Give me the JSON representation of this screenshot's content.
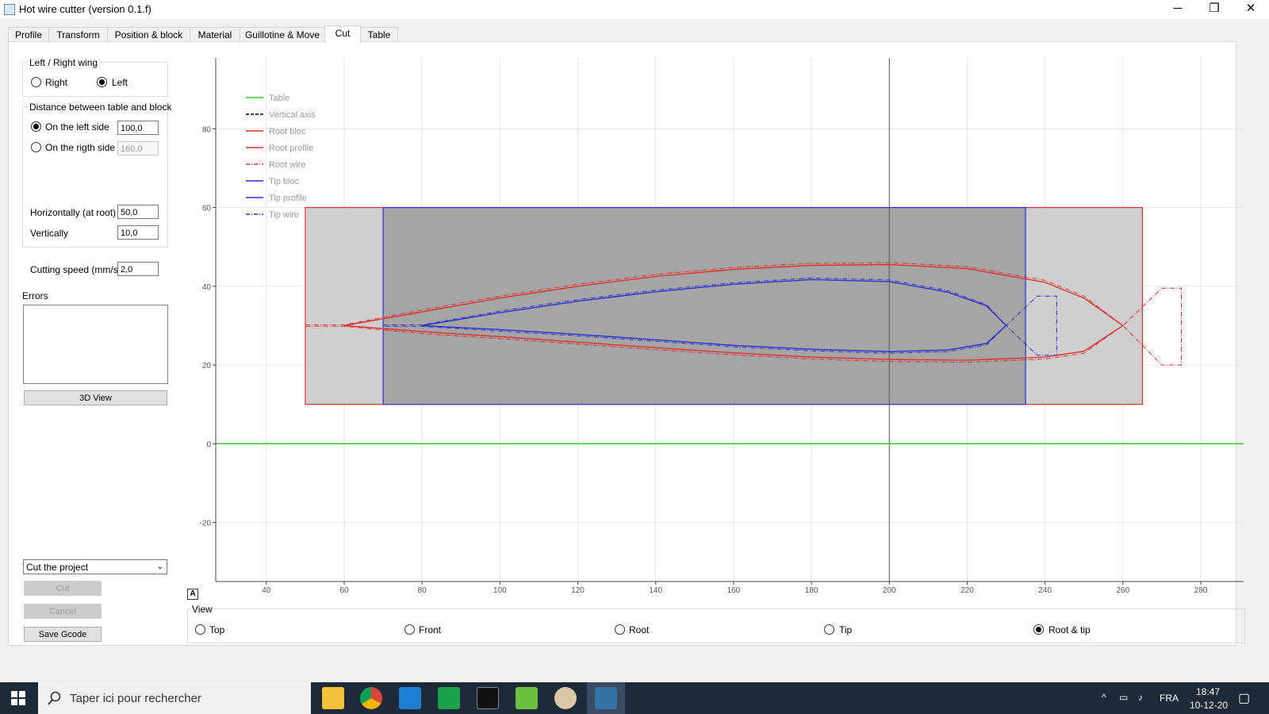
{
  "window": {
    "title": "Hot wire cutter (version 0.1.f)",
    "minimize": "─",
    "maximize": "❐",
    "close": "✕"
  },
  "tabs": [
    "Profile",
    "Transform",
    "Position & block",
    "Material",
    "Guillotine & Move",
    "Cut",
    "Table"
  ],
  "active_tab": "Cut",
  "wing_group": {
    "title": "Left / Right wing",
    "right": "Right",
    "left": "Left",
    "selected": "Left"
  },
  "distance_group": {
    "title": "Distance between table and block",
    "left_side_label": "On the left side",
    "left_side_value": "100,0",
    "right_side_label": "On the rigth side",
    "right_side_value": "160,0",
    "selected": "left",
    "horiz_label": "Horizontally (at root)",
    "horiz_value": "50,0",
    "vert_label": "Vertically",
    "vert_value": "10,0"
  },
  "cutting_speed": {
    "label": "Cutting speed (mm/s)",
    "value": "2,0"
  },
  "errors": {
    "label": "Errors",
    "text": ""
  },
  "buttons": {
    "view3d": "3D View",
    "cut": "Cut",
    "cancel": "Cancel",
    "save_gcode": "Save Gcode"
  },
  "mode_combo": "Cut the project",
  "autoscale_glyph": "A",
  "view_group": {
    "title": "View",
    "options": [
      "Top",
      "Front",
      "Root",
      "Tip",
      "Root & tip"
    ],
    "selected": "Root & tip"
  },
  "chart_data": {
    "type": "line",
    "xlim": [
      27,
      291
    ],
    "ylim": [
      -35,
      98
    ],
    "x_ticks": [
      40,
      60,
      80,
      100,
      120,
      140,
      160,
      180,
      200,
      220,
      240,
      260,
      280
    ],
    "y_ticks": [
      -20,
      0,
      20,
      40,
      60,
      80
    ],
    "grid": true,
    "legend_position": "top-left",
    "legend": [
      {
        "name": "Table",
        "color": "#33cc33",
        "style": "solid"
      },
      {
        "name": "Vertical axis",
        "color": "#000000",
        "style": "dashed"
      },
      {
        "name": "Root bloc",
        "color": "#e03030",
        "style": "solid"
      },
      {
        "name": "Root profile",
        "color": "#e03030",
        "style": "solid"
      },
      {
        "name": "Root wire",
        "color": "#e03030",
        "style": "dashdot"
      },
      {
        "name": "Tip bloc",
        "color": "#2f2fd0",
        "style": "solid"
      },
      {
        "name": "Tip profile",
        "color": "#2f2fd0",
        "style": "solid"
      },
      {
        "name": "Tip wire",
        "color": "#2f2fd0",
        "style": "dashdot"
      }
    ],
    "table_y": 0,
    "vertical_axis_x": 200,
    "root_bloc": {
      "x": [
        50,
        265
      ],
      "y": [
        10,
        60
      ]
    },
    "tip_bloc": {
      "x": [
        70,
        235
      ],
      "y": [
        10,
        60
      ]
    },
    "root_profile": {
      "upper": [
        [
          60,
          30
        ],
        [
          80,
          33.5
        ],
        [
          100,
          37
        ],
        [
          120,
          40
        ],
        [
          140,
          42.5
        ],
        [
          160,
          44.3
        ],
        [
          180,
          45.3
        ],
        [
          200,
          45.5
        ],
        [
          220,
          44.5
        ],
        [
          240,
          41
        ],
        [
          250,
          37
        ],
        [
          260,
          30
        ]
      ],
      "lower": [
        [
          60,
          30
        ],
        [
          80,
          28.5
        ],
        [
          100,
          27.2
        ],
        [
          120,
          25.8
        ],
        [
          140,
          24.4
        ],
        [
          160,
          23.1
        ],
        [
          180,
          22
        ],
        [
          200,
          21.4
        ],
        [
          220,
          21.2
        ],
        [
          240,
          22
        ],
        [
          250,
          23.5
        ],
        [
          260,
          30
        ]
      ]
    },
    "tip_profile": {
      "upper": [
        [
          80,
          30
        ],
        [
          100,
          33.3
        ],
        [
          120,
          36.2
        ],
        [
          140,
          38.6
        ],
        [
          160,
          40.5
        ],
        [
          180,
          41.7
        ],
        [
          200,
          41.2
        ],
        [
          215,
          38.5
        ],
        [
          225,
          35
        ],
        [
          230,
          30
        ]
      ],
      "lower": [
        [
          80,
          30
        ],
        [
          100,
          29
        ],
        [
          120,
          27.8
        ],
        [
          140,
          26.4
        ],
        [
          160,
          25
        ],
        [
          180,
          24
        ],
        [
          200,
          23.4
        ],
        [
          215,
          23.8
        ],
        [
          225,
          25.5
        ],
        [
          230,
          30
        ]
      ]
    },
    "root_wire": [
      [
        50,
        30.2
      ],
      [
        60,
        30.2
      ],
      [
        80,
        34
      ],
      [
        100,
        37.5
      ],
      [
        120,
        40.5
      ],
      [
        140,
        43
      ],
      [
        160,
        44.8
      ],
      [
        180,
        45.8
      ],
      [
        200,
        46
      ],
      [
        220,
        45
      ],
      [
        240,
        41.5
      ],
      [
        250,
        37.5
      ],
      [
        260,
        30
      ],
      [
        270,
        39.5
      ],
      [
        275,
        39.5
      ],
      [
        275,
        20
      ],
      [
        270,
        20
      ],
      [
        260,
        30
      ],
      [
        250,
        23
      ],
      [
        240,
        21.5
      ],
      [
        220,
        20.7
      ],
      [
        200,
        20.9
      ],
      [
        180,
        21.5
      ],
      [
        160,
        22.6
      ],
      [
        140,
        23.9
      ],
      [
        120,
        25.3
      ],
      [
        100,
        26.7
      ],
      [
        80,
        28
      ],
      [
        60,
        29.8
      ],
      [
        50,
        29.8
      ]
    ],
    "tip_wire": [
      [
        70,
        30.2
      ],
      [
        80,
        30.2
      ],
      [
        100,
        33.7
      ],
      [
        120,
        36.6
      ],
      [
        140,
        39
      ],
      [
        160,
        40.9
      ],
      [
        180,
        42.1
      ],
      [
        200,
        41.6
      ],
      [
        215,
        38.9
      ],
      [
        225,
        35.3
      ],
      [
        230,
        30
      ],
      [
        238,
        37.5
      ],
      [
        243,
        37.5
      ],
      [
        243,
        22.5
      ],
      [
        238,
        22.5
      ],
      [
        230,
        30
      ],
      [
        225,
        25.1
      ],
      [
        215,
        23.4
      ],
      [
        200,
        23
      ],
      [
        180,
        23.6
      ],
      [
        160,
        24.6
      ],
      [
        140,
        26
      ],
      [
        120,
        27.4
      ],
      [
        100,
        28.6
      ],
      [
        80,
        29.8
      ],
      [
        70,
        29.8
      ]
    ]
  },
  "taskbar": {
    "search_placeholder": "Taper ici pour rechercher",
    "lang": "FRA",
    "time": "18:47",
    "date": "10-12-20"
  },
  "taskbar_icons": [
    "windows-start-icon",
    "search-icon",
    "file-explorer-icon",
    "chrome-icon",
    "vscode-icon",
    "dbeaver-icon",
    "terminal-icon",
    "notepad-icon",
    "paint-icon",
    "python-icon"
  ]
}
